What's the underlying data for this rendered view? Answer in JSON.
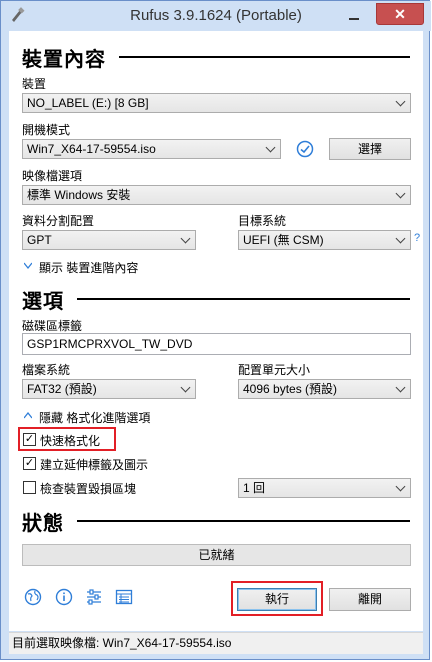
{
  "window": {
    "title": "Rufus 3.9.1624 (Portable)",
    "close_symbol": "✕"
  },
  "device_props": {
    "heading": "裝置內容",
    "device_label": "裝置",
    "device_value": "NO_LABEL (E:) [8 GB]",
    "boot_label": "開機模式",
    "boot_value": "Win7_X64-17-59554.iso",
    "select_button": "選擇",
    "image_option_label": "映像檔選項",
    "image_option_value": "標準 Windows 安裝",
    "partition_label": "資料分割配置",
    "partition_value": "GPT",
    "target_label": "目標系統",
    "target_value": "UEFI (無 CSM)",
    "help_symbol": "?",
    "advanced_toggle": "顯示 裝置進階內容"
  },
  "format_options": {
    "heading": "選項",
    "volume_label_label": "磁碟區標籤",
    "volume_label_value": "GSP1RMCPRXVOL_TW_DVD",
    "fs_label": "檔案系統",
    "fs_value": "FAT32 (預設)",
    "cluster_label": "配置單元大小",
    "cluster_value": "4096 bytes (預設)",
    "advanced_toggle": "隱藏 格式化進階選項",
    "quick_format": "快速格式化",
    "quick_format_checked": true,
    "extended_label": "建立延伸標籤及圖示",
    "extended_checked": true,
    "bad_blocks": "檢查裝置毀損區塊",
    "bad_blocks_checked": false,
    "passes_value": "1 回"
  },
  "status": {
    "heading": "狀態",
    "progress_text": "已就緒"
  },
  "actions": {
    "start_button": "執行",
    "close_button": "離開"
  },
  "icons": [
    "globe-icon",
    "info-icon",
    "settings-icon",
    "log-icon",
    "verify-check-icon",
    "rufus-app-icon"
  ],
  "statusbar": {
    "text": "目前選取映像檔: Win7_X64-17-59554.iso"
  },
  "colors": {
    "highlight": "#e21f26",
    "title_bar": "#cfe0f5",
    "accent": "#2f7ed8",
    "close_button": "#c75050"
  }
}
